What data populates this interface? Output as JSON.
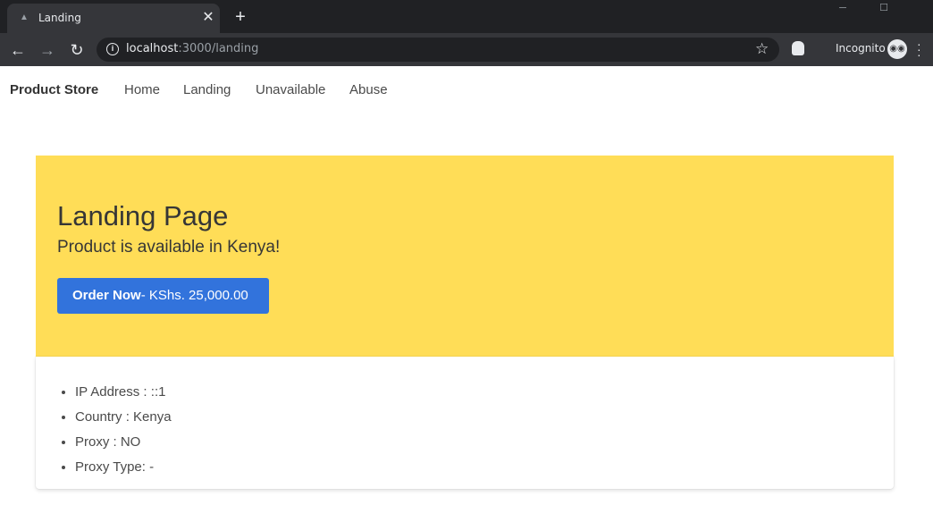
{
  "browser": {
    "tab_title": "Landing",
    "url_host": "localhost",
    "url_rest": ":3000/landing",
    "incognito_label": "Incognito"
  },
  "navbar": {
    "brand": "Product Store",
    "links": [
      "Home",
      "Landing",
      "Unavailable",
      "Abuse"
    ]
  },
  "hero": {
    "title": "Landing Page",
    "subtitle": "Product is available in Kenya!",
    "button_bold": "Order Now",
    "button_price": "- KShs. 25,000.00",
    "background_color": "#ffdd57",
    "button_color": "#3273dc"
  },
  "info": {
    "items": [
      "IP Address : ::1",
      "Country : Kenya",
      "Proxy : NO",
      "Proxy Type: -"
    ]
  }
}
